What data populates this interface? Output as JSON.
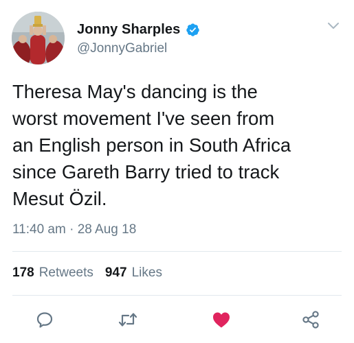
{
  "author": {
    "name": "Jonny Sharples",
    "handle": "@JonnyGabriel",
    "verified": true
  },
  "tweet": {
    "text": "Theresa May's dancing is the\nworst movement I've seen from\nan English person in South Africa\nsince Gareth Barry tried to track\nMesut Özil.",
    "timestamp": "11:40 am · 28 Aug 18"
  },
  "stats": {
    "retweets_count": "178",
    "retweets_label": "Retweets",
    "likes_count": "947",
    "likes_label": "Likes"
  },
  "actions": {
    "reply_icon": "reply-icon",
    "retweet_icon": "retweet-icon",
    "like_icon": "heart-icon",
    "like_active": true,
    "share_icon": "share-icon"
  },
  "colors": {
    "verified": "#1da1f2",
    "like_active": "#e0245e",
    "secondary_text": "#657786",
    "icon_gray": "#657786"
  }
}
